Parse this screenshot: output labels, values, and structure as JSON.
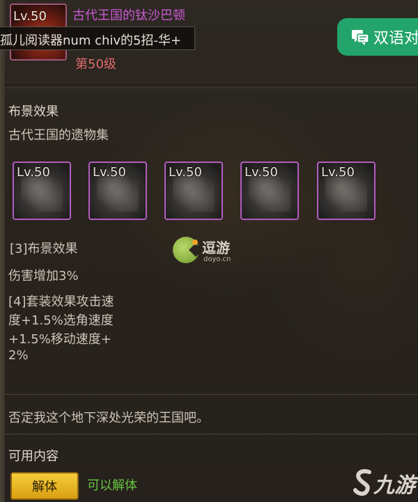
{
  "header": {
    "avatar_level": "Lv.50",
    "item_name": "古代王国的钛沙巴顿",
    "overlay_text": "孤儿阅读器num chiv的5招-华+",
    "item_level": "第50级",
    "bilingual_button": "双语对"
  },
  "set_effect": {
    "title": "布景效果",
    "set_name": "古代王国的遗物集",
    "slots": [
      {
        "level": "Lv.50"
      },
      {
        "level": "Lv.50"
      },
      {
        "level": "Lv.50"
      },
      {
        "level": "Lv.50"
      },
      {
        "level": "Lv.50"
      }
    ],
    "bonus3_title": "[3]布景效果",
    "bonus3_text": "伤害增加3%",
    "bonus4_lines": [
      "[4]套装效果攻击速",
      "度+1.5%选角速度",
      "+1.5%移动速度+",
      "2%"
    ]
  },
  "lore": "否定我这个地下深处光荣的王国吧。",
  "available": {
    "title": "可用内容",
    "disassemble_button": "解体",
    "disassemble_status": "可以解体"
  },
  "watermark": {
    "cn": "逗游",
    "en": "doyo.cn"
  },
  "brand": "九游",
  "colors": {
    "item_name": "#c85ad1",
    "item_level": "#de6b6b",
    "bilingual_button": "#22a46a",
    "slot_border": "#b35cc0",
    "disassemble_button": "#f2c22c",
    "disassemble_status": "#67c442"
  }
}
